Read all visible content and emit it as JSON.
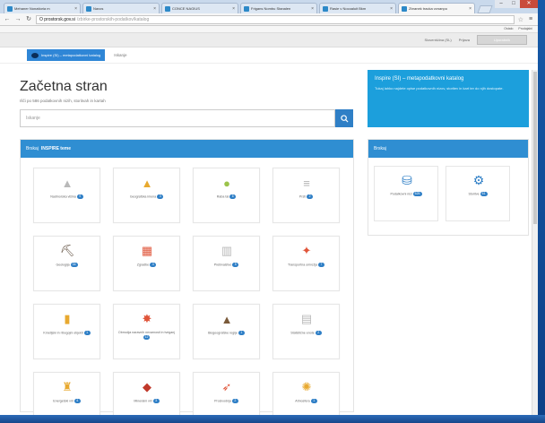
{
  "colors": {
    "accent": "#2f8ed2",
    "inspire": "#1c9fdc",
    "badge": "#2f7fc6"
  },
  "browser": {
    "tabs": [
      {
        "label": "Mehaner Nonatioria m",
        "active": false
      },
      {
        "label": "Navos",
        "active": false
      },
      {
        "label": "CONCE NAGIUS",
        "active": false
      },
      {
        "label": "Frigans Nombu Stanalen",
        "active": false
      },
      {
        "label": "Rasie v Nocoaluit Bkm",
        "active": false
      },
      {
        "label": "Zbranek tracka vznanpo",
        "active": true
      }
    ],
    "url_host": "O prostorsk.gov.si",
    "url_path": "/zbirke-prostorskih-podatkov/katalog",
    "bookmarks_right": [
      "Ostalo",
      "Prodajalni"
    ]
  },
  "topbar": {
    "lang": "Slovenščina (SL)",
    "home_link": "Prijava",
    "user_label": "Uporabnik"
  },
  "portal": {
    "button_label": "Inspire (SI) – metapodatkovni katalog",
    "link_label": "Iskanje"
  },
  "page": {
    "title": "Začetna stran",
    "subtitle": "Išči po 586 podatkovnih nizih, storitvah in kartah",
    "search_placeholder": "Iskanje",
    "search_icon": "search-icon"
  },
  "themes_panel": {
    "heading_prefix": "Brskaj",
    "heading_bold": "INSPIRE teme",
    "tiles": [
      {
        "icon": "mountain-icon",
        "color": "#b9b9b9",
        "label": "Nadmorska višina",
        "count": "9"
      },
      {
        "icon": "triangle-icon",
        "color": "#e8a92f",
        "label": "Geografska imena",
        "count": "3"
      },
      {
        "icon": "mound-icon",
        "color": "#9bc34a",
        "label": "Raba tal",
        "count": "6"
      },
      {
        "icon": "stack-icon",
        "color": "#b3b3b3",
        "label": "Prsti",
        "count": "2"
      },
      {
        "icon": "pick-icon",
        "color": "#5c4b3b",
        "label": "Geologija",
        "count": "34"
      },
      {
        "icon": "building-icon",
        "color": "#e0553a",
        "label": "Zgradbe",
        "count": "4"
      },
      {
        "icon": "factory-icon",
        "color": "#b9b9b9",
        "label": "Prebivalstvo",
        "count": "5"
      },
      {
        "icon": "network-icon",
        "color": "#e0553a",
        "label": "Transportna omrežja",
        "count": "7"
      },
      {
        "icon": "crop-icon",
        "color": "#e8a92f",
        "label": "Kmetijski in ribogojni objekti",
        "count": "1"
      },
      {
        "icon": "hazard-icon",
        "color": "#e0553a",
        "label": "Območja naravnih nevarnosti in tveganj",
        "count": "12"
      },
      {
        "icon": "peaks-icon",
        "color": "#7a5a3a",
        "label": "Biogeografske regije",
        "count": "1"
      },
      {
        "icon": "grid-icon",
        "color": "#b9b9b9",
        "label": "Statistične enote",
        "count": "2"
      },
      {
        "icon": "tower-icon",
        "color": "#e8a92f",
        "label": "Energetski viri",
        "count": "4"
      },
      {
        "icon": "diamond-icon",
        "color": "#c0392b",
        "label": "Mineralni viri",
        "count": "3"
      },
      {
        "icon": "chart-icon",
        "color": "#e0553a",
        "label": "Proizvodnja",
        "count": "2"
      },
      {
        "icon": "sun-icon",
        "color": "#e8a92f",
        "label": "Atmosfera",
        "count": "1"
      }
    ]
  },
  "inspire_box": {
    "title": "Inspire (SI) – metapodatkovni katalog",
    "description": "Tukaj lahko najdete opise podatkovnih nizov, storitev in kart ter do njih dostopate."
  },
  "right_panel": {
    "heading": "Brskaj",
    "tiles": [
      {
        "icon": "database-icon",
        "label": "Podatkovni nizi",
        "count": "525"
      },
      {
        "icon": "gear-icon",
        "label": "Storitve",
        "count": "61"
      }
    ]
  }
}
